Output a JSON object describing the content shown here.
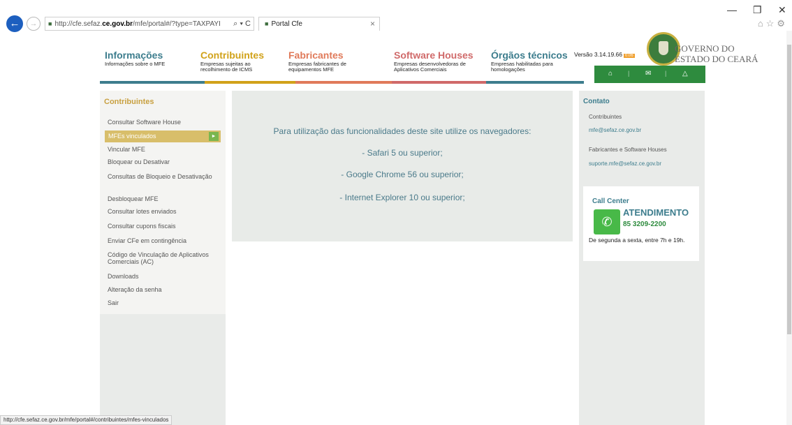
{
  "browser": {
    "address_prefix": "http://cfe.sefaz.",
    "address_domain": "ce.gov.br",
    "address_suffix": "/mfe/portal#/?type=TAXPAYI",
    "address_controls": "⌕ ▾ C",
    "tab_title": "Portal Cfe",
    "tab_close": "×",
    "status_url": "http://cfe.sefaz.ce.gov.br/mfe/portal#/contribuintes/mfes-vinculados"
  },
  "header": {
    "nav": [
      {
        "title": "Informações",
        "sub": "Informações sobre o MFE",
        "color": "#3d7d8d"
      },
      {
        "title": "Contribuintes",
        "sub": "Empresas sujeitas ao recolhimento de ICMS",
        "color": "#d1a21a"
      },
      {
        "title": "Fabricantes",
        "sub": "Empresas fabricantes de equipamentos MFE",
        "color": "#e07a5a"
      },
      {
        "title": "Software Houses",
        "sub": "Empresas desenvolvedoras de Aplicativos Comerciais",
        "color": "#d06a6a"
      },
      {
        "title": "Órgãos técnicos",
        "sub": "Empresas habilitadas para homologações",
        "color": "#3d7d8d"
      }
    ],
    "version": "Versão 3.14.19.66",
    "version_badge": "0.06",
    "gov_line1": "GOVERNO DO",
    "gov_line2": "ESTADO DO CEARÁ"
  },
  "sidebar": {
    "title": "Contribuintes",
    "items": [
      {
        "label": "Consultar Software House"
      },
      {
        "label": "MFEs vinculados",
        "active": true
      },
      {
        "label": "Vincular MFE"
      },
      {
        "label": "Bloquear ou Desativar"
      },
      {
        "label": "Consultas de Bloqueio e Desativação"
      },
      {
        "label": "Desbloquear MFE"
      },
      {
        "label": "Consultar lotes enviados"
      },
      {
        "label": "Consultar cupons fiscais"
      },
      {
        "label": "Enviar CFe em contingência"
      },
      {
        "label": "Código de Vinculação de Aplicativos Comerciais (AC)"
      },
      {
        "label": "Downloads"
      },
      {
        "label": "Alteração da senha"
      },
      {
        "label": "Sair"
      }
    ]
  },
  "main": {
    "intro": "Para utilização das funcionalidades deste site utilize os navegadores:",
    "browsers": [
      "- Safari 5 ou superior;",
      "- Google Chrome 56 ou superior;",
      "- Internet Explorer 10 ou superior;"
    ]
  },
  "contact": {
    "title": "Contato",
    "contrib_label": "Contribuintes",
    "contrib_email": "mfe@sefaz.ce.gov.br",
    "fab_label": "Fabricantes e Software Houses",
    "fab_email": "suporte.mfe@sefaz.ce.gov.br",
    "call_center_title": "Call Center",
    "atendimento": "ATENDIMENTO",
    "phone": "85 3209-2200",
    "hours": "De segunda a sexta, entre 7h e 19h."
  },
  "colors": {
    "accent_green": "#2e8b3e",
    "contrib_gold": "#d1a21a",
    "teal": "#3d7d8d"
  }
}
